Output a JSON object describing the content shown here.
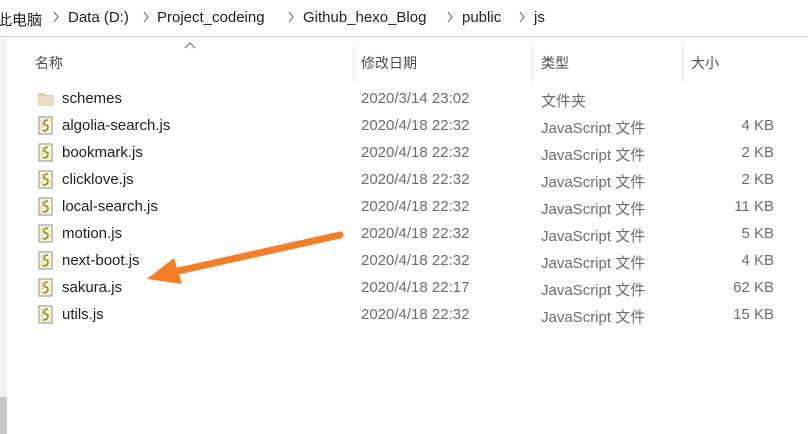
{
  "breadcrumb": [
    {
      "label": "此电脑"
    },
    {
      "label": "Data (D:)"
    },
    {
      "label": "Project_codeing"
    },
    {
      "label": "Github_hexo_Blog"
    },
    {
      "label": "public"
    },
    {
      "label": "js"
    }
  ],
  "columns": {
    "name": "名称",
    "date": "修改日期",
    "type": "类型",
    "size": "大小"
  },
  "files": [
    {
      "name": "schemes",
      "date": "2020/3/14 23:02",
      "type": "文件夹",
      "size": "",
      "icon": "folder-icon"
    },
    {
      "name": "algolia-search.js",
      "date": "2020/4/18 22:32",
      "type": "JavaScript 文件",
      "size": "4 KB",
      "icon": "js-file-icon"
    },
    {
      "name": "bookmark.js",
      "date": "2020/4/18 22:32",
      "type": "JavaScript 文件",
      "size": "2 KB",
      "icon": "js-file-icon"
    },
    {
      "name": "clicklove.js",
      "date": "2020/4/18 22:32",
      "type": "JavaScript 文件",
      "size": "2 KB",
      "icon": "js-file-icon"
    },
    {
      "name": "local-search.js",
      "date": "2020/4/18 22:32",
      "type": "JavaScript 文件",
      "size": "11 KB",
      "icon": "js-file-icon"
    },
    {
      "name": "motion.js",
      "date": "2020/4/18 22:32",
      "type": "JavaScript 文件",
      "size": "5 KB",
      "icon": "js-file-icon"
    },
    {
      "name": "next-boot.js",
      "date": "2020/4/18 22:32",
      "type": "JavaScript 文件",
      "size": "4 KB",
      "icon": "js-file-icon"
    },
    {
      "name": "sakura.js",
      "date": "2020/4/18 22:17",
      "type": "JavaScript 文件",
      "size": "62 KB",
      "icon": "js-file-icon"
    },
    {
      "name": "utils.js",
      "date": "2020/4/18 22:32",
      "type": "JavaScript 文件",
      "size": "15 KB",
      "icon": "js-file-icon"
    }
  ],
  "colors": {
    "annotation_arrow": "#f47f2a",
    "secondary_text": "#6d6d6d",
    "folder": "#d9cfb6"
  }
}
